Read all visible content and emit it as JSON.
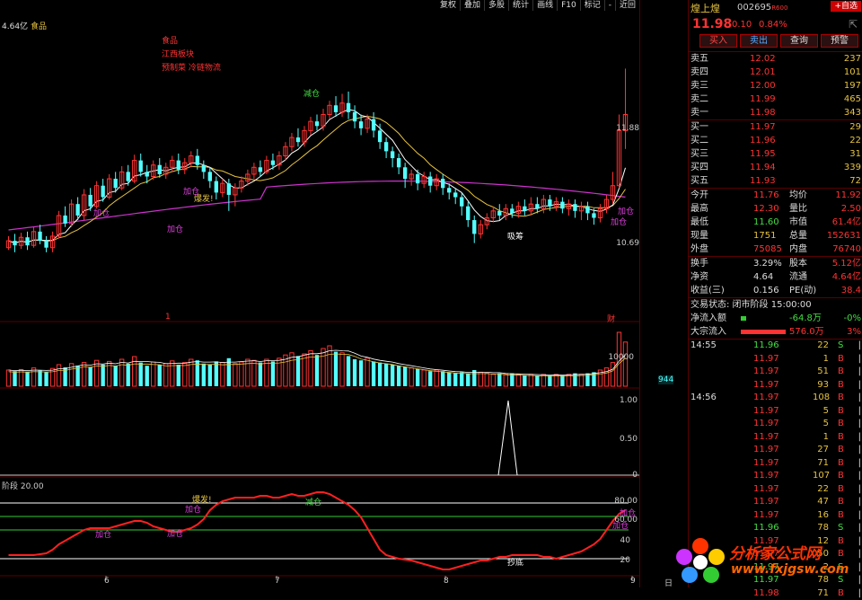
{
  "toolbar": {
    "items": [
      "复权",
      "叠加",
      "多股",
      "统计",
      "画线",
      "F10",
      "标记",
      "-",
      "近回"
    ]
  },
  "header": {
    "left_text": "4.64亿",
    "sector_label": "食品"
  },
  "annotations": [
    "食品",
    "江西板块",
    "预制菜 冷链物流"
  ],
  "price_axis": {
    "upper": "11.88",
    "lower": "10.69"
  },
  "volume_axis": {
    "top": "10000",
    "bottom": "944"
  },
  "ind1_axis": [
    "1.00",
    "0.50",
    "0"
  ],
  "ind2": {
    "label": "阶段 20.00",
    "axis": [
      "80.00",
      "60.00",
      "40",
      "20"
    ]
  },
  "date_axis": [
    "6",
    "7",
    "8",
    "9",
    "日"
  ],
  "bottom_marks": [
    "1",
    "财"
  ],
  "signals": {
    "jiacang": "加仓",
    "baofa": "爆发!",
    "jiancang": "减仓",
    "xichou": "吸筹",
    "chaodi": "抄底"
  },
  "colors": {
    "up": "#ff3333",
    "down": "#54ffff",
    "ma1": "#ffffff",
    "ma2": "#e6c340",
    "ma3": "#cc33cc",
    "osc": "#ff2020"
  },
  "panel": {
    "name": "煌上煌",
    "code": "002695",
    "code_suffix": "R600",
    "add_btn": "+自选",
    "price": "11.98",
    "change": "0.10",
    "pct": "0.84%",
    "buttons": [
      "买入",
      "卖出",
      "查询",
      "预警"
    ],
    "asks": [
      {
        "label": "卖五",
        "price": "12.02",
        "vol": "237"
      },
      {
        "label": "卖四",
        "price": "12.01",
        "vol": "101"
      },
      {
        "label": "卖三",
        "price": "12.00",
        "vol": "197"
      },
      {
        "label": "卖二",
        "price": "11.99",
        "vol": "465"
      },
      {
        "label": "卖一",
        "price": "11.98",
        "vol": "343"
      }
    ],
    "bids": [
      {
        "label": "买一",
        "price": "11.97",
        "vol": "29"
      },
      {
        "label": "买二",
        "price": "11.96",
        "vol": "22"
      },
      {
        "label": "买三",
        "price": "11.95",
        "vol": "31"
      },
      {
        "label": "买四",
        "price": "11.94",
        "vol": "339"
      },
      {
        "label": "买五",
        "price": "11.93",
        "vol": "72"
      }
    ],
    "stats1": [
      {
        "l1": "今开",
        "v1": "11.76",
        "l2": "均价",
        "v2": "11.92"
      },
      {
        "l1": "最高",
        "v1": "12.30",
        "l2": "量比",
        "v2": "2.50"
      },
      {
        "l1": "最低",
        "v1": "11.60",
        "l2": "市值",
        "v2": "61.4亿"
      },
      {
        "l1": "现量",
        "v1": "1751",
        "l2": "总量",
        "v2": "152631"
      },
      {
        "l1": "外盘",
        "v1": "75085",
        "l2": "内盘",
        "v2": "76740"
      }
    ],
    "stats2": [
      {
        "l1": "换手",
        "v1": "3.29%",
        "l2": "股本",
        "v2": "5.12亿"
      },
      {
        "l1": "净资",
        "v1": "4.64",
        "l2": "流通",
        "v2": "4.64亿"
      },
      {
        "l1": "收益(三)",
        "v1": "0.156",
        "l2": "PE(动)",
        "v2": "38.4"
      }
    ],
    "status": "交易状态: 闭市阶段 15:00:00",
    "flow": [
      {
        "label": "净流入额",
        "value": "-64.8万",
        "pct": "-0%"
      },
      {
        "label": "大宗流入",
        "value": "576.0万",
        "pct": "3%"
      }
    ],
    "ticks": [
      {
        "t": "14:55",
        "p": "11.96",
        "v": "22",
        "s": "S"
      },
      {
        "t": "",
        "p": "11.97",
        "v": "1",
        "s": "B"
      },
      {
        "t": "",
        "p": "11.97",
        "v": "51",
        "s": "B"
      },
      {
        "t": "",
        "p": "11.97",
        "v": "93",
        "s": "B"
      },
      {
        "t": "14:56",
        "p": "11.97",
        "v": "108",
        "s": "B"
      },
      {
        "t": "",
        "p": "11.97",
        "v": "5",
        "s": "B"
      },
      {
        "t": "",
        "p": "11.97",
        "v": "5",
        "s": "B"
      },
      {
        "t": "",
        "p": "11.97",
        "v": "1",
        "s": "B"
      },
      {
        "t": "",
        "p": "11.97",
        "v": "27",
        "s": "B"
      },
      {
        "t": "",
        "p": "11.97",
        "v": "71",
        "s": "B"
      },
      {
        "t": "",
        "p": "11.97",
        "v": "107",
        "s": "B"
      },
      {
        "t": "",
        "p": "11.97",
        "v": "22",
        "s": "B"
      },
      {
        "t": "",
        "p": "11.97",
        "v": "47",
        "s": "B"
      },
      {
        "t": "",
        "p": "11.97",
        "v": "16",
        "s": "B"
      },
      {
        "t": "",
        "p": "11.96",
        "v": "78",
        "s": "S"
      },
      {
        "t": "",
        "p": "11.97",
        "v": "12",
        "s": "B"
      },
      {
        "t": "",
        "p": "11.97",
        "v": "50",
        "s": "B"
      },
      {
        "t": "",
        "p": "11.97",
        "v": "2",
        "s": "S"
      },
      {
        "t": "",
        "p": "11.97",
        "v": "78",
        "s": "S"
      },
      {
        "t": "",
        "p": "11.98",
        "v": "71",
        "s": "B"
      }
    ]
  },
  "watermark": {
    "title": "分析家公式网",
    "url": "www.fxjgsw.com"
  },
  "candles": [
    [
      10.74,
      10.8,
      10.84,
      10.72
    ],
    [
      10.8,
      10.76,
      10.86,
      10.7
    ],
    [
      10.76,
      10.83,
      10.87,
      10.73
    ],
    [
      10.83,
      10.76,
      10.88,
      10.72
    ],
    [
      10.76,
      10.88,
      10.92,
      10.74
    ],
    [
      10.88,
      10.8,
      10.94,
      10.77
    ],
    [
      10.8,
      10.74,
      10.84,
      10.7
    ],
    [
      10.74,
      10.84,
      10.88,
      10.7
    ],
    [
      10.84,
      11.02,
      11.06,
      10.82
    ],
    [
      11.02,
      10.95,
      11.1,
      10.92
    ],
    [
      10.95,
      11.12,
      11.16,
      10.92
    ],
    [
      11.12,
      11.02,
      11.18,
      10.98
    ],
    [
      11.02,
      11.2,
      11.25,
      10.98
    ],
    [
      11.2,
      11.1,
      11.26,
      11.06
    ],
    [
      11.1,
      11.28,
      11.32,
      11.08
    ],
    [
      11.28,
      11.18,
      11.34,
      11.14
    ],
    [
      11.18,
      11.34,
      11.38,
      11.16
    ],
    [
      11.34,
      11.26,
      11.4,
      11.22
    ],
    [
      11.26,
      11.4,
      11.45,
      11.24
    ],
    [
      11.4,
      11.32,
      11.46,
      11.28
    ],
    [
      11.32,
      11.5,
      11.55,
      11.3
    ],
    [
      11.5,
      11.4,
      11.56,
      11.36
    ],
    [
      11.4,
      11.36,
      11.46,
      11.3
    ],
    [
      11.36,
      11.46,
      11.5,
      11.33
    ],
    [
      11.46,
      11.38,
      11.52,
      11.35
    ],
    [
      11.38,
      11.44,
      11.48,
      11.34
    ],
    [
      11.44,
      11.5,
      11.54,
      11.4
    ],
    [
      11.5,
      11.42,
      11.56,
      11.38
    ],
    [
      11.42,
      11.48,
      11.52,
      11.38
    ],
    [
      11.48,
      11.54,
      11.58,
      11.44
    ],
    [
      11.54,
      11.46,
      11.6,
      11.42
    ],
    [
      11.46,
      11.4,
      11.5,
      11.34
    ],
    [
      11.4,
      11.32,
      11.44,
      11.26
    ],
    [
      11.32,
      11.22,
      11.36,
      11.16
    ],
    [
      11.22,
      11.3,
      11.34,
      11.18
    ],
    [
      11.3,
      11.2,
      11.34,
      11.06
    ],
    [
      11.2,
      11.26,
      11.3,
      11.1
    ],
    [
      11.26,
      11.32,
      11.36,
      11.22
    ],
    [
      11.32,
      11.38,
      11.42,
      11.28
    ],
    [
      11.38,
      11.44,
      11.48,
      11.34
    ],
    [
      11.44,
      11.4,
      11.5,
      11.36
    ],
    [
      11.4,
      11.5,
      11.54,
      11.38
    ],
    [
      11.5,
      11.46,
      11.56,
      11.42
    ],
    [
      11.46,
      11.54,
      11.58,
      11.42
    ],
    [
      11.54,
      11.62,
      11.66,
      11.5
    ],
    [
      11.62,
      11.7,
      11.74,
      11.58
    ],
    [
      11.7,
      11.66,
      11.78,
      11.62
    ],
    [
      11.66,
      11.76,
      11.8,
      11.62
    ],
    [
      11.76,
      11.84,
      11.88,
      11.72
    ],
    [
      11.84,
      11.8,
      11.9,
      11.76
    ],
    [
      11.8,
      11.9,
      11.95,
      11.76
    ],
    [
      11.9,
      11.98,
      12.02,
      11.86
    ],
    [
      11.98,
      11.92,
      12.06,
      11.88
    ],
    [
      11.92,
      12.0,
      12.08,
      11.88
    ],
    [
      12.0,
      11.92,
      12.1,
      11.86
    ],
    [
      11.92,
      11.84,
      11.98,
      11.78
    ],
    [
      11.84,
      11.78,
      11.9,
      11.72
    ],
    [
      11.78,
      11.86,
      11.9,
      11.74
    ],
    [
      11.86,
      11.76,
      11.92,
      11.7
    ],
    [
      11.76,
      11.66,
      11.82,
      11.6
    ],
    [
      11.66,
      11.58,
      11.7,
      11.52
    ],
    [
      11.58,
      11.52,
      11.62,
      11.44
    ],
    [
      11.52,
      11.44,
      11.56,
      11.38
    ],
    [
      11.44,
      11.34,
      11.48,
      11.26
    ],
    [
      11.34,
      11.38,
      11.42,
      11.28
    ],
    [
      11.38,
      11.3,
      11.42,
      11.24
    ],
    [
      11.3,
      11.36,
      11.4,
      11.26
    ],
    [
      11.36,
      11.28,
      11.4,
      11.22
    ],
    [
      11.28,
      11.34,
      11.38,
      11.24
    ],
    [
      11.34,
      11.26,
      11.38,
      11.2
    ],
    [
      11.26,
      11.22,
      11.3,
      11.16
    ],
    [
      11.22,
      11.18,
      11.26,
      11.12
    ],
    [
      11.18,
      11.1,
      11.22,
      11.02
    ],
    [
      11.1,
      10.98,
      11.14,
      10.92
    ],
    [
      10.98,
      10.86,
      11.02,
      10.78
    ],
    [
      10.86,
      10.94,
      10.98,
      10.82
    ],
    [
      10.94,
      11.0,
      11.04,
      10.9
    ],
    [
      11.0,
      11.06,
      11.1,
      10.96
    ],
    [
      11.06,
      11.02,
      11.12,
      10.98
    ],
    [
      11.02,
      11.08,
      11.12,
      10.98
    ],
    [
      11.08,
      11.04,
      11.12,
      11.0
    ],
    [
      11.04,
      11.1,
      11.14,
      11.0
    ],
    [
      11.1,
      11.06,
      11.16,
      11.02
    ],
    [
      11.06,
      11.12,
      11.18,
      11.02
    ],
    [
      11.12,
      11.08,
      11.18,
      11.04
    ],
    [
      11.08,
      11.16,
      11.2,
      11.04
    ],
    [
      11.16,
      11.1,
      11.2,
      11.06
    ],
    [
      11.1,
      11.14,
      11.18,
      11.06
    ],
    [
      11.14,
      11.08,
      11.18,
      11.04
    ],
    [
      11.08,
      11.12,
      11.16,
      11.02
    ],
    [
      11.12,
      11.06,
      11.16,
      11.0
    ],
    [
      11.06,
      11.1,
      11.14,
      10.98
    ],
    [
      11.1,
      11.04,
      11.14,
      10.98
    ],
    [
      11.04,
      11.0,
      11.08,
      10.94
    ],
    [
      11.0,
      11.08,
      11.12,
      10.96
    ],
    [
      11.08,
      11.16,
      11.2,
      11.04
    ],
    [
      11.16,
      11.28,
      11.4,
      11.12
    ],
    [
      11.28,
      11.76,
      11.9,
      11.26
    ],
    [
      11.76,
      11.9,
      12.3,
      11.6
    ]
  ],
  "volumes": [
    0.3,
    0.28,
    0.31,
    0.27,
    0.34,
    0.29,
    0.26,
    0.33,
    0.4,
    0.35,
    0.42,
    0.38,
    0.44,
    0.36,
    0.48,
    0.4,
    0.46,
    0.38,
    0.5,
    0.42,
    0.55,
    0.44,
    0.38,
    0.45,
    0.4,
    0.42,
    0.47,
    0.4,
    0.44,
    0.5,
    0.48,
    0.42,
    0.4,
    0.46,
    0.44,
    0.52,
    0.42,
    0.45,
    0.5,
    0.48,
    0.44,
    0.5,
    0.46,
    0.52,
    0.58,
    0.62,
    0.56,
    0.6,
    0.66,
    0.58,
    0.7,
    0.75,
    0.64,
    0.62,
    0.56,
    0.5,
    0.48,
    0.52,
    0.46,
    0.44,
    0.42,
    0.4,
    0.38,
    0.36,
    0.34,
    0.32,
    0.3,
    0.28,
    0.3,
    0.28,
    0.26,
    0.24,
    0.26,
    0.24,
    0.3,
    0.26,
    0.24,
    0.22,
    0.24,
    0.22,
    0.24,
    0.22,
    0.2,
    0.22,
    0.2,
    0.22,
    0.2,
    0.22,
    0.2,
    0.22,
    0.24,
    0.22,
    0.24,
    0.26,
    0.3,
    0.34,
    0.44,
    1.0,
    0.82
  ],
  "osc": [
    22,
    22,
    22,
    22,
    22,
    23,
    24,
    28,
    34,
    38,
    42,
    46,
    50,
    52,
    52,
    52,
    52,
    54,
    56,
    58,
    60,
    60,
    58,
    54,
    52,
    50,
    48,
    48,
    50,
    52,
    56,
    62,
    72,
    78,
    82,
    84,
    86,
    86,
    86,
    86,
    88,
    88,
    86,
    86,
    88,
    90,
    88,
    88,
    90,
    92,
    92,
    90,
    86,
    82,
    78,
    72,
    64,
    52,
    40,
    28,
    22,
    20,
    18,
    17,
    16,
    14,
    12,
    10,
    8,
    6,
    6,
    8,
    10,
    12,
    14,
    16,
    16,
    18,
    20,
    20,
    22,
    22,
    22,
    22,
    22,
    20,
    20,
    18,
    20,
    22,
    24,
    26,
    30,
    34,
    40,
    50,
    60,
    68,
    72
  ]
}
